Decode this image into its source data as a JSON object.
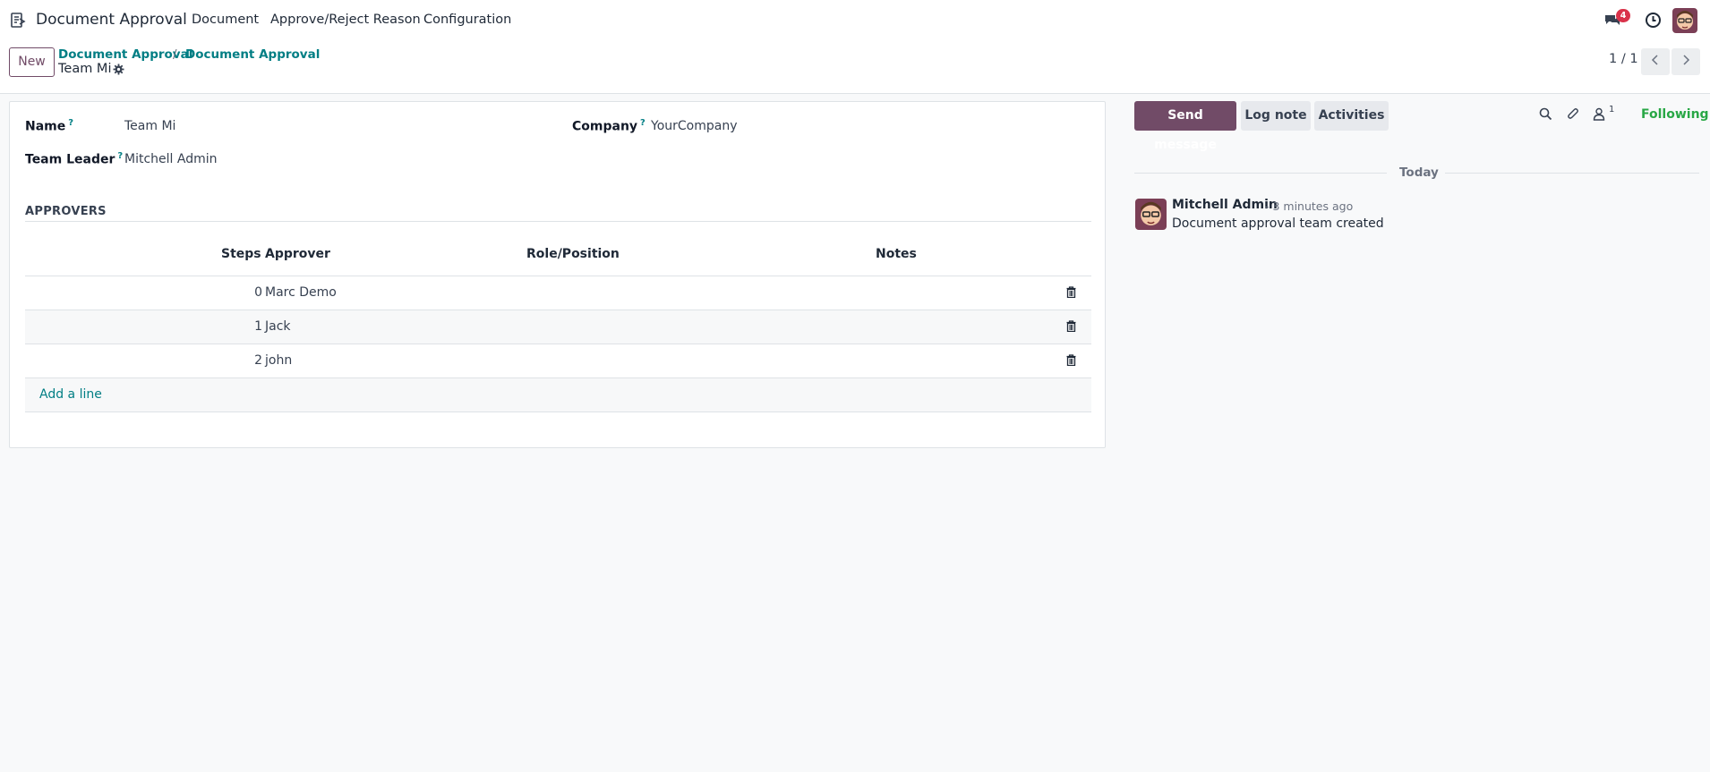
{
  "app": {
    "title": "Document Approval",
    "menu": [
      "Document",
      "Approve/Reject Reason",
      "Configuration"
    ],
    "messages_badge": "4"
  },
  "control": {
    "new_label": "New",
    "breadcrumbs": [
      "Document Approval",
      "Document Approval"
    ],
    "breadcrumb_separator": "/",
    "record_name": "Team Mi",
    "pager": "1 / 1"
  },
  "form": {
    "name_label": "Name",
    "name_value": "Team Mi",
    "company_label": "Company",
    "company_value": "YourCompany",
    "leader_label": "Team Leader",
    "leader_value": "Mitchell Admin",
    "help_mark": "?",
    "section_title": "APPROVERS",
    "columns": [
      "Steps",
      "Approver",
      "Role/Position",
      "Notes"
    ],
    "rows": [
      {
        "step": "0",
        "approver": "Marc Demo"
      },
      {
        "step": "1",
        "approver": "Jack"
      },
      {
        "step": "2",
        "approver": "john"
      }
    ],
    "add_line": "Add a line"
  },
  "chatter": {
    "send_message": "Send message",
    "log_note": "Log note",
    "activities": "Activities",
    "followers_count": "1",
    "following": "Following",
    "date_separator": "Today",
    "message": {
      "author": "Mitchell Admin",
      "time": "- 3 minutes ago",
      "body": "Document approval team created"
    }
  },
  "colors": {
    "brand": "#714B67",
    "link": "#017e84",
    "following": "#28a745",
    "badge": "#d9324a"
  },
  "icons": [
    "app-icon",
    "messages-icon",
    "clock-icon",
    "user-avatar",
    "gear-icon",
    "chevron-left-icon",
    "chevron-right-icon",
    "trash-icon",
    "search-icon",
    "paperclip-icon",
    "followers-icon"
  ]
}
